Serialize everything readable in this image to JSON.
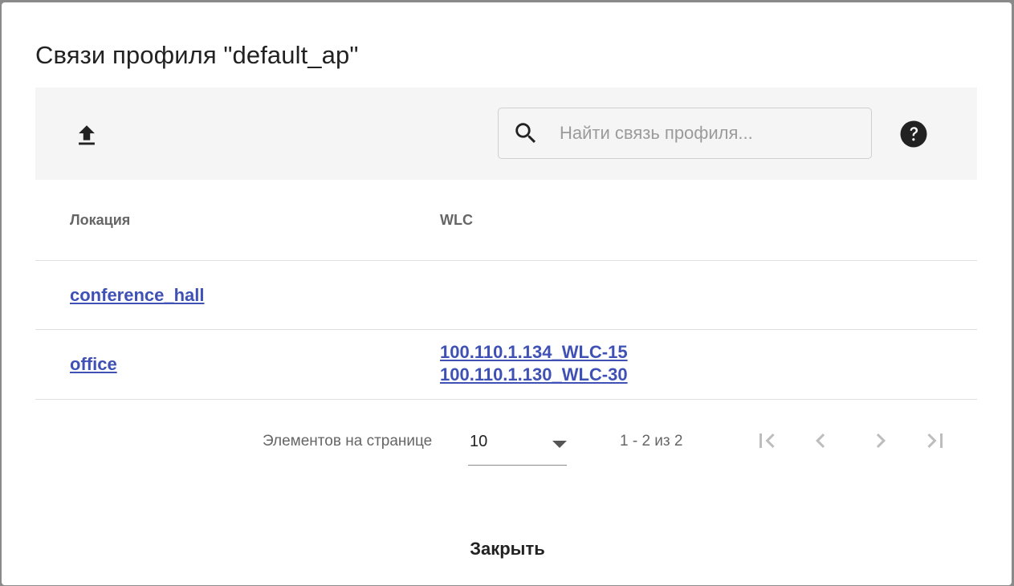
{
  "dialog": {
    "title": "Связи профиля \"default_ap\""
  },
  "toolbar": {
    "upload_icon": "upload-icon",
    "search_placeholder": "Найти связь профиля...",
    "search_value": "",
    "search_icon": "search-icon",
    "help_icon": "help-icon"
  },
  "table": {
    "columns": [
      "Локация",
      "WLC"
    ],
    "rows": [
      {
        "location": "conference_hall",
        "wlc": []
      },
      {
        "location": "office",
        "wlc": [
          "100.110.1.134_WLC-15",
          "100.110.1.130_WLC-30"
        ]
      }
    ]
  },
  "paginator": {
    "items_per_page_label": "Элементов на странице",
    "page_size": "10",
    "range_label": "1 - 2 из 2",
    "first_icon": "first-page-icon",
    "prev_icon": "prev-page-icon",
    "next_icon": "next-page-icon",
    "last_icon": "last-page-icon"
  },
  "actions": {
    "close_label": "Закрыть"
  },
  "colors": {
    "link": "#3f51b5",
    "toolbar_bg": "#f5f5f5",
    "divider": "#e0e0e0",
    "overlay": "#8a8a8a"
  }
}
